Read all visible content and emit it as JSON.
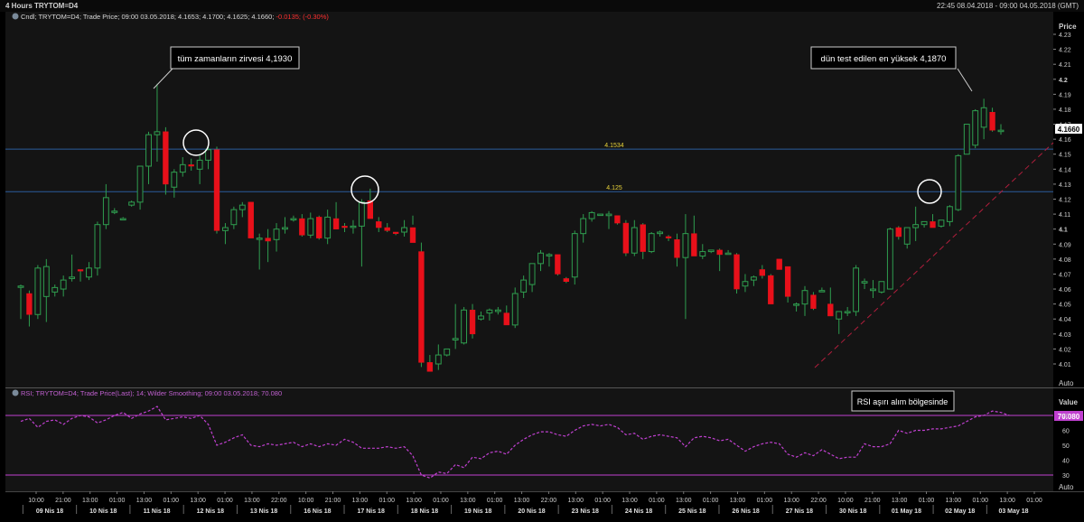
{
  "window": {
    "title": "4 Hours TRYTOM=D4",
    "range": "22:45 08.04.2018 - 09:00 04.05.2018 (GMT)"
  },
  "main_panel": {
    "legend_plain": "Cndl; TRYTOM=D4; Trade Price; 09:00 03.05.2018; 4.1653; 4.1700; 4.1625; 4.1660;",
    "legend_change": "-0.0135; (-0.30%)",
    "price_header": "Price",
    "last_price": "4.1660",
    "auto_label": "Auto",
    "y_ticks": [
      "4.23",
      "4.22",
      "4.21",
      "4.2",
      "4.19",
      "4.18",
      "4.17",
      "4.16",
      "4.15",
      "4.14",
      "4.13",
      "4.12",
      "4.11",
      "4.1",
      "4.09",
      "4.08",
      "4.07",
      "4.06",
      "4.05",
      "4.04",
      "4.03",
      "4.02",
      "4.01"
    ],
    "hlines": [
      {
        "label": "4.1534",
        "value": 4.1534
      },
      {
        "label": "4.125",
        "value": 4.125
      }
    ],
    "annotations": [
      "tüm zamanların zirvesi 4,1930",
      "dün test edilen en yüksek 4,1870"
    ]
  },
  "rsi_panel": {
    "legend": "RSI; TRYTOM=D4; Trade Price(Last); 14; Wilder Smoothing; 09:00 03.05.2018; 70.080",
    "value_header": "Value",
    "last_value": "70.080",
    "auto_label": "Auto",
    "y_ticks": [
      "70",
      "60",
      "50",
      "40",
      "30"
    ],
    "annotation": "RSI aşırı alım bölgesinde"
  },
  "x_axis": {
    "hour_ticks": [
      "10:00",
      "21:00",
      "13:00",
      "01:00",
      "13:00",
      "01:00",
      "13:00",
      "01:00",
      "13:00",
      "22:00",
      "10:00",
      "21:00",
      "13:00",
      "01:00",
      "13:00",
      "01:00",
      "13:00",
      "01:00",
      "13:00",
      "22:00",
      "13:00",
      "01:00",
      "13:00",
      "01:00",
      "13:00",
      "01:00",
      "13:00",
      "01:00",
      "13:00",
      "22:00",
      "10:00",
      "21:00",
      "13:00",
      "01:00",
      "13:00",
      "01:00",
      "13:00",
      "01:00"
    ],
    "date_ticks": [
      "09 Nis 18",
      "10 Nis 18",
      "11 Nis 18",
      "12 Nis 18",
      "13 Nis 18",
      "16 Nis 18",
      "17 Nis 18",
      "18 Nis 18",
      "19 Nis 18",
      "20 Nis 18",
      "23 Nis 18",
      "24 Nis 18",
      "25 Nis 18",
      "26 Nis 18",
      "27 Nis 18",
      "30 Nis 18",
      "01 May 18",
      "02 May 18",
      "03 May 18"
    ]
  },
  "colors": {
    "up": "#2f9e4f",
    "down": "#e8101a",
    "hline": "#2a5c9c",
    "rsi": "#c040d0",
    "trend": "#b01e3c"
  },
  "chart_data": [
    {
      "type": "candlestick",
      "title": "4 Hours TRYTOM=D4",
      "ylim": [
        4.005,
        4.235
      ],
      "candles": [
        [
          4.062,
          4.063,
          4.04,
          4.062
        ],
        [
          4.057,
          4.059,
          4.035,
          4.043
        ],
        [
          4.043,
          4.076,
          4.04,
          4.074
        ],
        [
          4.055,
          4.08,
          4.038,
          4.075
        ],
        [
          4.058,
          4.063,
          4.055,
          4.061
        ],
        [
          4.06,
          4.069,
          4.055,
          4.066
        ],
        [
          4.067,
          4.083,
          4.065,
          4.068
        ],
        [
          4.073,
          4.072,
          4.065,
          4.072
        ],
        [
          4.068,
          4.078,
          4.066,
          4.074
        ],
        [
          4.074,
          4.105,
          4.069,
          4.103
        ],
        [
          4.103,
          4.13,
          4.1,
          4.121
        ],
        [
          4.112,
          4.114,
          4.11,
          4.112
        ],
        [
          4.107,
          4.108,
          4.106,
          4.107
        ],
        [
          4.116,
          4.119,
          4.115,
          4.118
        ],
        [
          4.118,
          4.142,
          4.113,
          4.142
        ],
        [
          4.142,
          4.165,
          4.13,
          4.163
        ],
        [
          4.163,
          4.197,
          4.145,
          4.165
        ],
        [
          4.165,
          4.168,
          4.123,
          4.13
        ],
        [
          4.128,
          4.14,
          4.121,
          4.138
        ],
        [
          4.138,
          4.148,
          4.135,
          4.143
        ],
        [
          4.143,
          4.147,
          4.139,
          4.142
        ],
        [
          4.14,
          4.15,
          4.13,
          4.146
        ],
        [
          4.146,
          4.155,
          4.14,
          4.153
        ],
        [
          4.153,
          4.155,
          4.097,
          4.099
        ],
        [
          4.099,
          4.104,
          4.09,
          4.101
        ],
        [
          4.103,
          4.115,
          4.1,
          4.113
        ],
        [
          4.113,
          4.118,
          4.108,
          4.116
        ],
        [
          4.118,
          4.118,
          4.094,
          4.094
        ],
        [
          4.094,
          4.097,
          4.073,
          4.094
        ],
        [
          4.094,
          4.1,
          4.078,
          4.092
        ],
        [
          4.093,
          4.104,
          4.085,
          4.1
        ],
        [
          4.1,
          4.108,
          4.097,
          4.101
        ],
        [
          4.107,
          4.109,
          4.105,
          4.107
        ],
        [
          4.107,
          4.11,
          4.095,
          4.096
        ],
        [
          4.096,
          4.111,
          4.094,
          4.107
        ],
        [
          4.108,
          4.109,
          4.093,
          4.094
        ],
        [
          4.094,
          4.113,
          4.09,
          4.108
        ],
        [
          4.107,
          4.118,
          4.1,
          4.1
        ],
        [
          4.102,
          4.104,
          4.098,
          4.101
        ],
        [
          4.102,
          4.106,
          4.097,
          4.102
        ],
        [
          4.102,
          4.12,
          4.075,
          4.118
        ],
        [
          4.119,
          4.127,
          4.113,
          4.107
        ],
        [
          4.105,
          4.108,
          4.098,
          4.101
        ],
        [
          4.101,
          4.104,
          4.098,
          4.099
        ],
        [
          4.098,
          4.097,
          4.096,
          4.097
        ],
        [
          4.098,
          4.106,
          4.095,
          4.101
        ],
        [
          4.101,
          4.109,
          4.103,
          4.091
        ],
        [
          4.085,
          4.091,
          4.008,
          4.011
        ],
        [
          4.011,
          4.016,
          4.005,
          4.005
        ],
        [
          4.01,
          4.023,
          4.006,
          4.016
        ],
        [
          4.016,
          4.02,
          4.015,
          4.02
        ],
        [
          4.026,
          4.05,
          4.02,
          4.027
        ],
        [
          4.024,
          4.048,
          4.023,
          4.046
        ],
        [
          4.046,
          4.05,
          4.027,
          4.03
        ],
        [
          4.04,
          4.045,
          4.039,
          4.042
        ],
        [
          4.044,
          4.047,
          4.039,
          4.046
        ],
        [
          4.045,
          4.048,
          4.043,
          4.046
        ],
        [
          4.044,
          4.049,
          4.036,
          4.036
        ],
        [
          4.036,
          4.061,
          4.034,
          4.057
        ],
        [
          4.058,
          4.069,
          4.054,
          4.066
        ],
        [
          4.063,
          4.077,
          4.058,
          4.077
        ],
        [
          4.077,
          4.086,
          4.072,
          4.084
        ],
        [
          4.083,
          4.084,
          4.075,
          4.083
        ],
        [
          4.083,
          4.082,
          4.069,
          4.07
        ],
        [
          4.067,
          4.068,
          4.064,
          4.065
        ],
        [
          4.068,
          4.099,
          4.063,
          4.097
        ],
        [
          4.097,
          4.11,
          4.091,
          4.107
        ],
        [
          4.107,
          4.112,
          4.105,
          4.111
        ],
        [
          4.11,
          4.11,
          4.109,
          4.11
        ],
        [
          4.109,
          4.112,
          4.1,
          4.11
        ],
        [
          4.109,
          4.108,
          4.103,
          4.104
        ],
        [
          4.104,
          4.106,
          4.082,
          4.084
        ],
        [
          4.084,
          4.106,
          4.082,
          4.101
        ],
        [
          4.103,
          4.104,
          4.08,
          4.085
        ],
        [
          4.085,
          4.098,
          4.084,
          4.097
        ],
        [
          4.097,
          4.099,
          4.095,
          4.098
        ],
        [
          4.095,
          4.096,
          4.092,
          4.094
        ],
        [
          4.093,
          4.097,
          4.075,
          4.081
        ],
        [
          4.081,
          4.11,
          4.04,
          4.097
        ],
        [
          4.097,
          4.109,
          4.084,
          4.082
        ],
        [
          4.082,
          4.09,
          4.08,
          4.085
        ],
        [
          4.085,
          4.086,
          4.084,
          4.086
        ],
        [
          4.086,
          4.087,
          4.072,
          4.083
        ],
        [
          4.084,
          4.086,
          4.083,
          4.084
        ],
        [
          4.083,
          4.084,
          4.057,
          4.06
        ],
        [
          4.062,
          4.07,
          4.058,
          4.065
        ],
        [
          4.066,
          4.069,
          4.062,
          4.068
        ],
        [
          4.073,
          4.076,
          4.067,
          4.069
        ],
        [
          4.069,
          4.07,
          4.05,
          4.05
        ],
        [
          4.08,
          4.08,
          4.073,
          4.073
        ],
        [
          4.075,
          4.07,
          4.051,
          4.055
        ],
        [
          4.05,
          4.051,
          4.045,
          4.05
        ],
        [
          4.05,
          4.062,
          4.042,
          4.059
        ],
        [
          4.056,
          4.058,
          4.046,
          4.047
        ],
        [
          4.059,
          4.061,
          4.058,
          4.059
        ],
        [
          4.05,
          4.061,
          4.042,
          4.042
        ],
        [
          4.04,
          4.044,
          4.03,
          4.045
        ],
        [
          4.045,
          4.048,
          4.042,
          4.045
        ],
        [
          4.045,
          4.076,
          4.042,
          4.074
        ],
        [
          4.064,
          4.067,
          4.06,
          4.065
        ],
        [
          4.059,
          4.066,
          4.054,
          4.06
        ],
        [
          4.058,
          4.065,
          4.057,
          4.065
        ],
        [
          4.06,
          4.101,
          4.06,
          4.1
        ],
        [
          4.101,
          4.102,
          4.093,
          4.095
        ],
        [
          4.09,
          4.101,
          4.087,
          4.101
        ],
        [
          4.101,
          4.115,
          4.092,
          4.103
        ],
        [
          4.103,
          4.105,
          4.101,
          4.105
        ],
        [
          4.105,
          4.11,
          4.101,
          4.101
        ],
        [
          4.102,
          4.106,
          4.101,
          4.106
        ],
        [
          4.105,
          4.116,
          4.102,
          4.115
        ],
        [
          4.113,
          4.15,
          4.112,
          4.149
        ],
        [
          4.15,
          4.17,
          4.153,
          4.17
        ],
        [
          4.156,
          4.18,
          4.154,
          4.179
        ],
        [
          4.168,
          4.187,
          4.16,
          4.181
        ],
        [
          4.178,
          4.181,
          4.165,
          4.166
        ],
        [
          4.166,
          4.17,
          4.163,
          4.166
        ]
      ]
    },
    {
      "type": "line",
      "title": "RSI; TRYTOM=D4; Trade Price(Last); 14; Wilder Smoothing",
      "ylim": [
        25,
        75
      ],
      "reference_levels": [
        70,
        30
      ],
      "values": [
        66,
        68,
        62,
        66,
        67,
        64,
        68,
        70,
        69,
        65,
        67,
        70,
        72,
        68,
        71,
        73,
        76,
        67,
        68,
        69,
        68,
        70,
        64,
        50,
        52,
        55,
        57,
        50,
        49,
        51,
        50,
        51,
        52,
        49,
        51,
        49,
        51,
        50,
        54,
        52,
        48,
        48,
        48,
        49,
        48,
        49,
        43,
        30,
        28,
        32,
        31,
        37,
        35,
        42,
        41,
        45,
        46,
        44,
        50,
        54,
        57,
        59,
        59,
        57,
        56,
        60,
        63,
        64,
        63,
        64,
        62,
        57,
        58,
        54,
        56,
        57,
        56,
        55,
        49,
        55,
        56,
        55,
        53,
        54,
        50,
        46,
        49,
        51,
        52,
        51,
        44,
        42,
        45,
        43,
        47,
        44,
        41,
        42,
        42,
        51,
        49,
        49,
        51,
        60,
        58,
        60,
        60,
        61,
        61,
        62,
        63,
        66,
        69,
        70,
        73,
        72,
        70
      ]
    }
  ]
}
